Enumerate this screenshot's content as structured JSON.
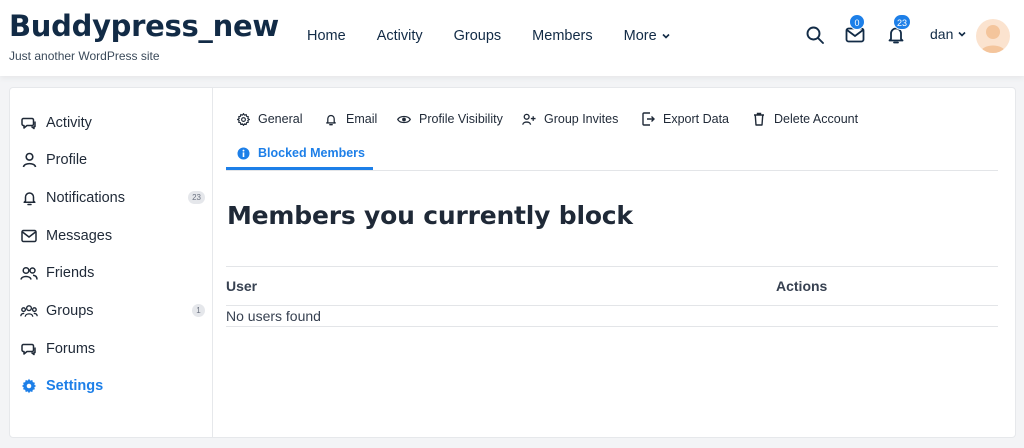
{
  "site": {
    "title": "Buddypress_new",
    "tagline": "Just another WordPress site"
  },
  "nav": {
    "home": "Home",
    "activity": "Activity",
    "groups": "Groups",
    "members": "Members",
    "more": "More"
  },
  "header": {
    "messages_count": "0",
    "notifications_count": "23",
    "username": "dan"
  },
  "sidebar": {
    "items": [
      {
        "label": "Activity",
        "icon": "activity-icon"
      },
      {
        "label": "Profile",
        "icon": "user-icon"
      },
      {
        "label": "Notifications",
        "icon": "bell-icon",
        "count": "23"
      },
      {
        "label": "Messages",
        "icon": "envelope-icon"
      },
      {
        "label": "Friends",
        "icon": "friends-icon"
      },
      {
        "label": "Groups",
        "icon": "groups-icon",
        "count": "1"
      },
      {
        "label": "Forums",
        "icon": "forums-icon"
      },
      {
        "label": "Settings",
        "icon": "gear-icon",
        "active": true
      }
    ]
  },
  "settings_tabs": {
    "general": "General",
    "email": "Email",
    "profile_visibility": "Profile Visibility",
    "group_invites": "Group Invites",
    "export_data": "Export Data",
    "delete_account": "Delete Account",
    "blocked_members": "Blocked Members"
  },
  "main": {
    "title": "Members you currently block",
    "table": {
      "headers": {
        "user": "User",
        "actions": "Actions"
      },
      "empty_message": "No users found"
    }
  },
  "colors": {
    "accent": "#1d7fe8",
    "brand": "#122b46"
  }
}
